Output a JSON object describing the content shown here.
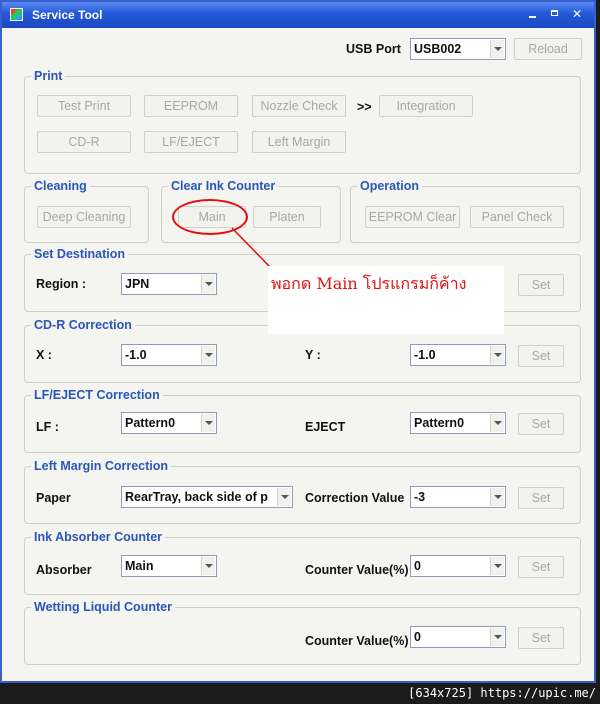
{
  "window": {
    "title": "Service Tool"
  },
  "usb": {
    "label": "USB Port",
    "value": "USB002",
    "reload_label": "Reload"
  },
  "print": {
    "legend": "Print",
    "test_print": "Test Print",
    "eeprom": "EEPROM",
    "nozzle_check": "Nozzle Check",
    "arrow": ">>",
    "integration": "Integration",
    "cdr": "CD-R",
    "lf_eject": "LF/EJECT",
    "left_margin": "Left Margin"
  },
  "cleaning": {
    "legend": "Cleaning",
    "deep_cleaning": "Deep Cleaning"
  },
  "clear_ink_counter": {
    "legend": "Clear Ink Counter",
    "main": "Main",
    "platen": "Platen"
  },
  "operation": {
    "legend": "Operation",
    "eeprom_clear": "EEPROM Clear",
    "panel_check": "Panel Check"
  },
  "set_destination": {
    "legend": "Set Destination",
    "region_label": "Region :",
    "region_value": "JPN",
    "set": "Set"
  },
  "cdr_correction": {
    "legend": "CD-R Correction",
    "x_label": "X :",
    "x_value": "-1.0",
    "y_label": "Y :",
    "y_value": "-1.0",
    "set": "Set"
  },
  "lf_eject_correction": {
    "legend": "LF/EJECT Correction",
    "lf_label": "LF :",
    "lf_value": "Pattern0",
    "eject_label": "EJECT",
    "eject_value": "Pattern0",
    "set": "Set"
  },
  "left_margin_correction": {
    "legend": "Left Margin Correction",
    "paper_label": "Paper",
    "paper_value": "RearTray, back side of p",
    "cv_label": "Correction Value",
    "cv_value": "-3",
    "set": "Set"
  },
  "ink_absorber_counter": {
    "legend": "Ink Absorber Counter",
    "absorber_label": "Absorber",
    "absorber_value": "Main",
    "cv_label": "Counter Value(%)",
    "cv_value": "0",
    "set": "Set"
  },
  "wetting_liquid_counter": {
    "legend": "Wetting Liquid Counter",
    "cv_label": "Counter Value(%)",
    "cv_value": "0",
    "set": "Set"
  },
  "annotation": {
    "text": "พอกด Main โปรแกรมก็ค้าง"
  },
  "footer": {
    "text": "[634x725] https://upic.me/"
  },
  "icons": {
    "accent": "#2a56b8",
    "annotation_color": "#e01010"
  }
}
